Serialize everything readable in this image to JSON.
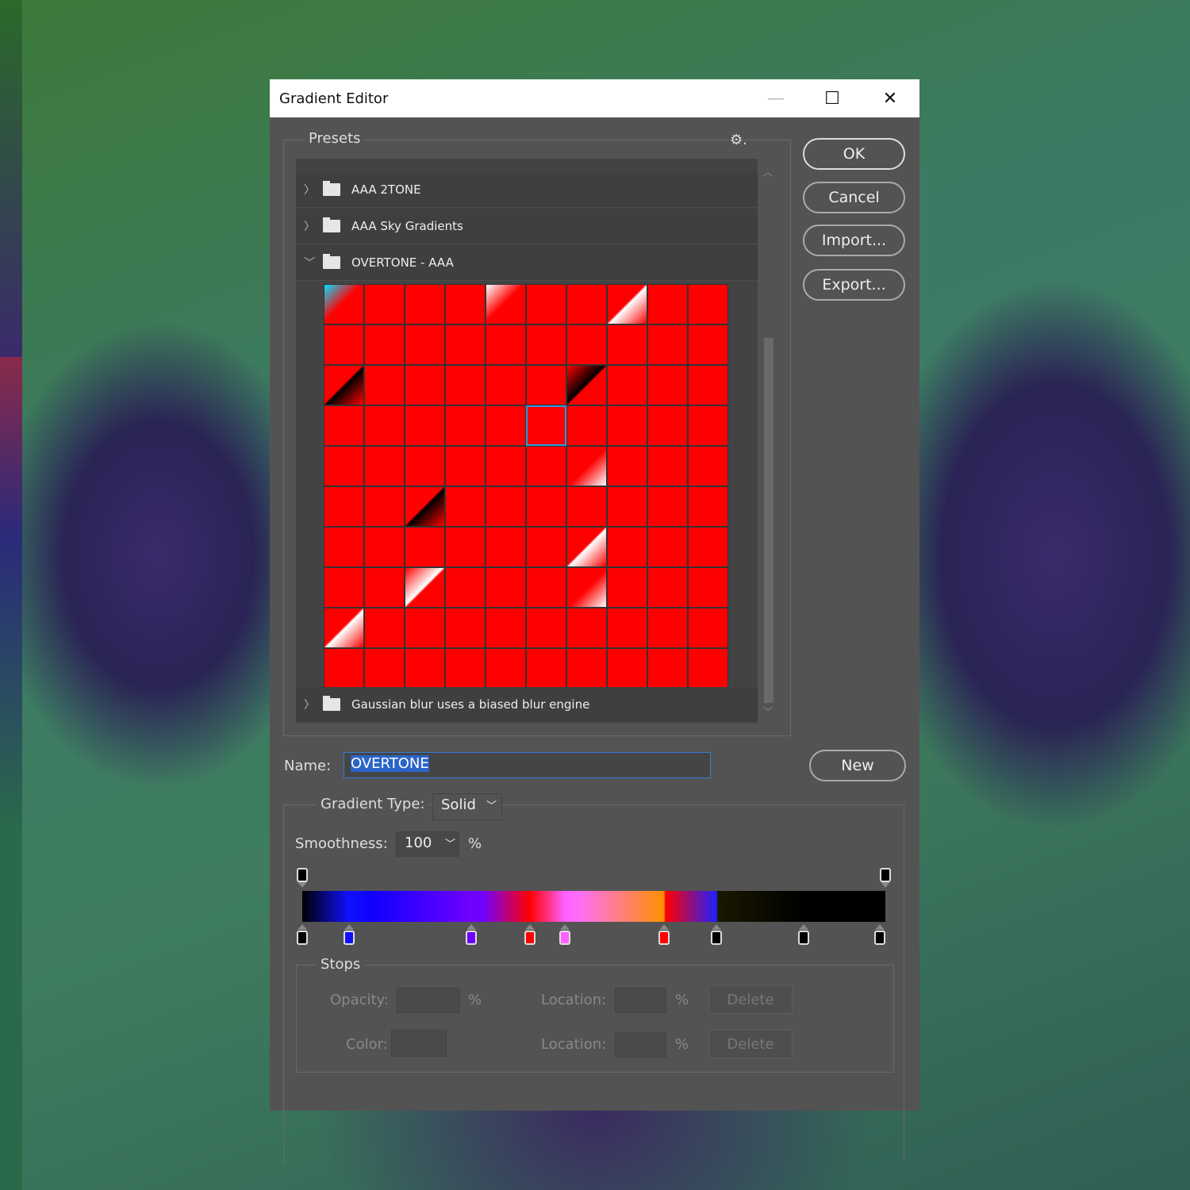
{
  "dialog": {
    "title": "Gradient Editor",
    "minimize": "—",
    "maximize": "☐",
    "close": "✕"
  },
  "presets": {
    "label": "Presets",
    "gear": "⚙.",
    "folders": [
      {
        "label": "AAA 2TONE",
        "expanded": false
      },
      {
        "label": "AAA Sky Gradients",
        "expanded": false
      },
      {
        "label": "OVERTONE - AAA",
        "expanded": true
      },
      {
        "label": "Gaussian blur uses a biased blur engine",
        "expanded": false
      }
    ],
    "swatch_palette": [
      "#ff0000",
      "#ff8a00",
      "#ffe600",
      "#00ff3c",
      "#00e1ff",
      "#1a1aff",
      "#8a00ff",
      "#ff00c8",
      "#ffffff",
      "#000000",
      "#ff5c8a",
      "#9cff5c",
      "#5ce1b0",
      "#ffb0d8",
      "#2ad6ff",
      "#d6ff2a"
    ],
    "selected_index": 35
  },
  "buttons": {
    "ok": "OK",
    "cancel": "Cancel",
    "import": "Import...",
    "export": "Export...",
    "new": "New"
  },
  "name": {
    "label": "Name:",
    "value": "OVERTONE"
  },
  "gradient_type": {
    "label": "Gradient Type:",
    "value": "Solid"
  },
  "smoothness": {
    "label": "Smoothness:",
    "value": "100",
    "unit": "%"
  },
  "gradient": {
    "opacity_stops": [
      0,
      100
    ],
    "color_stops": [
      {
        "location": 0,
        "color": "#000000"
      },
      {
        "location": 8,
        "color": "#1010ff"
      },
      {
        "location": 29,
        "color": "#7000ff"
      },
      {
        "location": 39,
        "color": "#ff0000"
      },
      {
        "location": 45,
        "color": "#ff60ff"
      },
      {
        "location": 62,
        "color": "#ff0000"
      },
      {
        "location": 71,
        "color": "#000000"
      },
      {
        "location": 86,
        "color": "#000000"
      },
      {
        "location": 99,
        "color": "#000000"
      }
    ]
  },
  "stops": {
    "label": "Stops",
    "opacity_label": "Opacity:",
    "percent": "%",
    "location_label": "Location:",
    "delete": "Delete",
    "color_label": "Color:"
  }
}
